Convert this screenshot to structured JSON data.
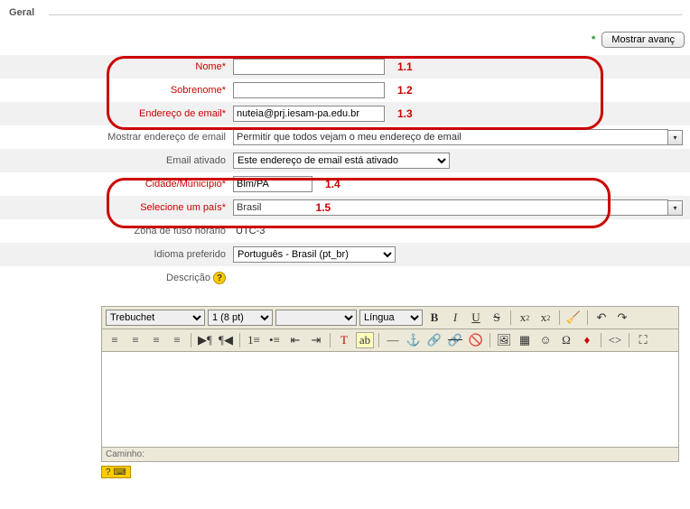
{
  "legend": "Geral",
  "top": {
    "advanced_button": "Mostrar avanç"
  },
  "fields": {
    "nome": {
      "label": "Nome",
      "value": "",
      "annot": "1.1"
    },
    "sobrenome": {
      "label": "Sobrenome",
      "value": "",
      "annot": "1.2"
    },
    "email": {
      "label": "Endereço de email",
      "value": "nuteia@prj.iesam-pa.edu.br",
      "annot": "1.3"
    },
    "mostrar_email": {
      "label": "Mostrar endereço de email",
      "value": "Permitir que todos vejam o meu endereço de email"
    },
    "email_ativado": {
      "label": "Email ativado",
      "value": "Este endereço de email está ativado"
    },
    "cidade": {
      "label": "Cidade/Município",
      "value": "Blm/PA",
      "annot": "1.4"
    },
    "pais": {
      "label": "Selecione um país",
      "value": "Brasil",
      "annot": "1.5"
    },
    "fuso": {
      "label": "Zona de fuso horário",
      "value": "UTC-3"
    },
    "idioma": {
      "label": "Idioma preferido",
      "value": "Português - Brasil (pt_br)"
    },
    "descricao": {
      "label": "Descrição"
    }
  },
  "editor": {
    "font": "Trebuchet",
    "size": "1 (8 pt)",
    "lang": "Língua",
    "path_label": "Caminho:"
  }
}
